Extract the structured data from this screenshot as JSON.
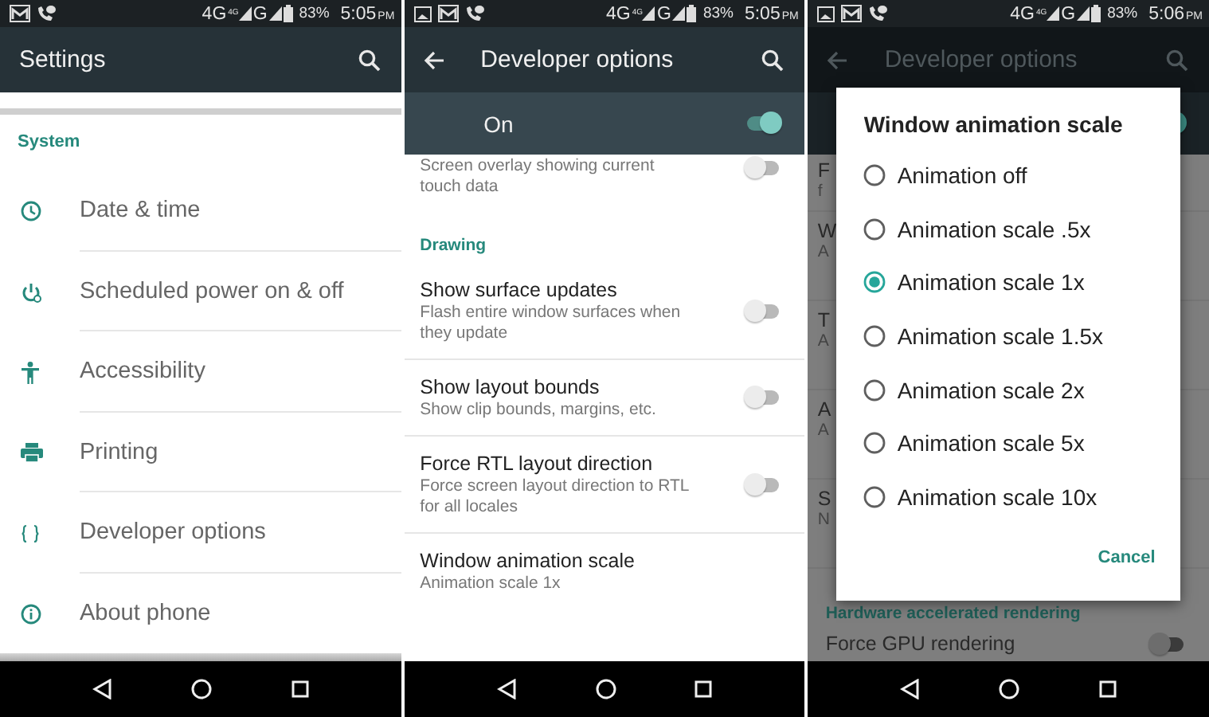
{
  "settings_screen": {
    "status_bar": {
      "network": "4G",
      "signal_badge": "4G",
      "network_2": "G",
      "battery": "83%",
      "time": "5:05",
      "meridiem": "PM"
    },
    "toolbar": {
      "title": "Settings"
    },
    "section": "System",
    "items": [
      {
        "label": "Date & time",
        "kind": "clock"
      },
      {
        "label": "Scheduled power on & off",
        "kind": "power"
      },
      {
        "label": "Accessibility",
        "kind": "accessibility"
      },
      {
        "label": "Printing",
        "kind": "print"
      },
      {
        "label": "Developer options",
        "kind": "braces"
      },
      {
        "label": "About phone",
        "kind": "info"
      }
    ]
  },
  "developer_screen": {
    "status_bar": {
      "network": "4G",
      "signal_badge": "4G",
      "network_2": "G",
      "battery": "83%",
      "time": "5:05",
      "meridiem": "PM"
    },
    "toolbar": {
      "title": "Developer options"
    },
    "master_switch": {
      "label": "On",
      "on": true
    },
    "items": [
      {
        "kind": "toggle",
        "subtitle": "Screen overlay showing current touch data",
        "on": false
      },
      {
        "kind": "header",
        "title": "Drawing"
      },
      {
        "kind": "toggle",
        "title": "Show surface updates",
        "subtitle": "Flash entire window surfaces when they update",
        "on": false
      },
      {
        "kind": "toggle",
        "title": "Show layout bounds",
        "subtitle": "Show clip bounds, margins, etc.",
        "on": false
      },
      {
        "kind": "toggle",
        "title": "Force RTL layout direction",
        "subtitle": "Force screen layout direction to RTL for all locales",
        "on": false
      },
      {
        "kind": "plain",
        "title": "Window animation scale",
        "subtitle": "Animation scale 1x"
      }
    ]
  },
  "dialog_screen": {
    "status_bar": {
      "network": "4G",
      "signal_badge": "4G",
      "network_2": "G",
      "battery": "83%",
      "time": "5:06",
      "meridiem": "PM"
    },
    "toolbar": {
      "title": "Developer options"
    },
    "master_switch": {
      "on": true
    },
    "background_rows": [
      {
        "title": "F",
        "subtitle": "f"
      },
      {
        "title": "W",
        "subtitle": "A"
      },
      {
        "title": "T",
        "subtitle": "A"
      },
      {
        "title": "A",
        "subtitle": "A"
      },
      {
        "title": "S",
        "subtitle": "N"
      }
    ],
    "section": "Hardware accelerated rendering",
    "last_row": {
      "title": "Force GPU rendering",
      "on": false
    },
    "dialog": {
      "title": "Window animation scale",
      "options": [
        {
          "label": "Animation off",
          "selected": false
        },
        {
          "label": "Animation scale .5x",
          "selected": false
        },
        {
          "label": "Animation scale 1x",
          "selected": true
        },
        {
          "label": "Animation scale 1.5x",
          "selected": false
        },
        {
          "label": "Animation scale 2x",
          "selected": false
        },
        {
          "label": "Animation scale 5x",
          "selected": false
        },
        {
          "label": "Animation scale 10x",
          "selected": false
        }
      ],
      "cancel": "Cancel"
    }
  }
}
